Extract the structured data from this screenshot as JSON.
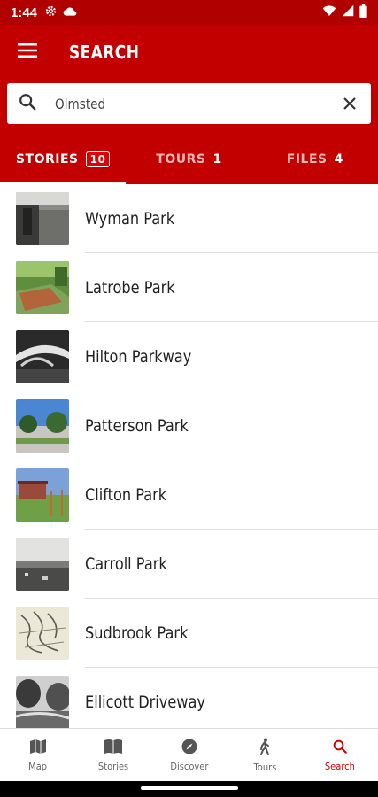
{
  "status_bar": {
    "time": "1:44",
    "left_icons": [
      "gear-icon",
      "cloud-icon"
    ],
    "right_icons": [
      "wifi-icon",
      "signal-icon",
      "battery-icon"
    ]
  },
  "app_bar": {
    "title": "SEARCH",
    "menu_icon": "hamburger-menu-icon"
  },
  "search": {
    "value": "Olmsted",
    "icon": "search-icon",
    "clear_icon": "close-icon"
  },
  "tabs": [
    {
      "label": "STORIES",
      "count": "10",
      "active": true
    },
    {
      "label": "TOURS",
      "count": "1",
      "active": false
    },
    {
      "label": "FILES",
      "count": "4",
      "active": false
    }
  ],
  "results": [
    {
      "title": "Wyman Park"
    },
    {
      "title": "Latrobe Park"
    },
    {
      "title": "Hilton Parkway"
    },
    {
      "title": "Patterson Park"
    },
    {
      "title": "Clifton Park"
    },
    {
      "title": "Carroll Park"
    },
    {
      "title": "Sudbrook Park"
    },
    {
      "title": "Ellicott Driveway"
    }
  ],
  "bottom_nav": [
    {
      "label": "Map",
      "icon": "map-icon",
      "active": false
    },
    {
      "label": "Stories",
      "icon": "book-icon",
      "active": false
    },
    {
      "label": "Discover",
      "icon": "compass-icon",
      "active": false
    },
    {
      "label": "Tours",
      "icon": "walking-icon",
      "active": false
    },
    {
      "label": "Search",
      "icon": "search-icon",
      "active": true
    }
  ],
  "colors": {
    "primary": "#c30000",
    "status_bar": "#b00000",
    "active_nav": "#d00000",
    "badge": "#e00000"
  }
}
